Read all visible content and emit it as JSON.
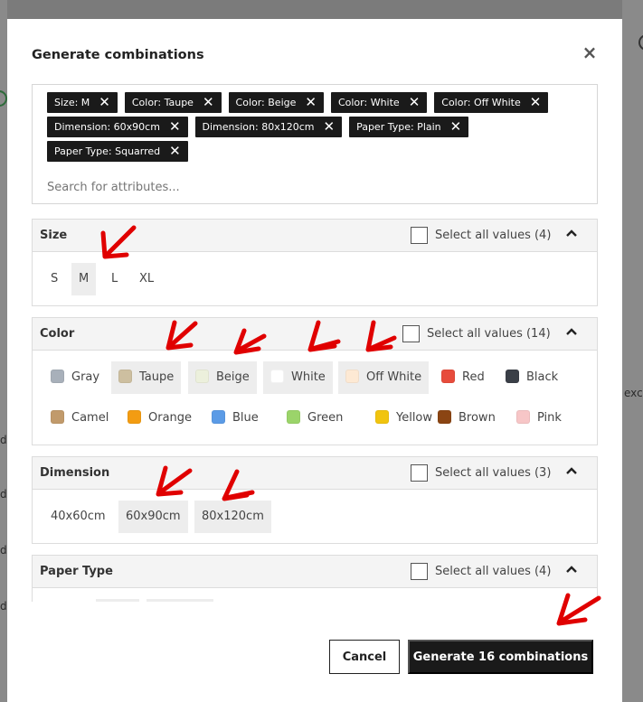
{
  "modal": {
    "title": "Generate combinations",
    "close_icon": "×"
  },
  "tags": [
    {
      "label": "Size: M"
    },
    {
      "label": "Color: Taupe"
    },
    {
      "label": "Color: Beige"
    },
    {
      "label": "Color: White"
    },
    {
      "label": "Color: Off White"
    },
    {
      "label": "Dimension: 60x90cm"
    },
    {
      "label": "Dimension: 80x120cm"
    },
    {
      "label": "Paper Type: Plain"
    },
    {
      "label": "Paper Type: Squarred"
    }
  ],
  "tag_remove_glyph": "✕",
  "search": {
    "placeholder": "Search for attributes..."
  },
  "sections": {
    "size": {
      "title": "Size",
      "select_all": "Select all values (4)",
      "values": [
        "S",
        "M",
        "L",
        "XL"
      ],
      "selected": [
        "M"
      ]
    },
    "color": {
      "title": "Color",
      "select_all": "Select all values (14)",
      "values": [
        {
          "label": "Gray",
          "color": "#a8b0ba"
        },
        {
          "label": "Taupe",
          "color": "#cdbfa0"
        },
        {
          "label": "Beige",
          "color": "#ecf0dc"
        },
        {
          "label": "White",
          "color": "#ffffff"
        },
        {
          "label": "Off White",
          "color": "#fde9d4"
        },
        {
          "label": "Red",
          "color": "#e74c3c"
        },
        {
          "label": "Black",
          "color": "#3a3f47"
        },
        {
          "label": "Camel",
          "color": "#c19a6b"
        },
        {
          "label": "Orange",
          "color": "#f39c12"
        },
        {
          "label": "Blue",
          "color": "#5b9be6"
        },
        {
          "label": "Green",
          "color": "#9bd46a"
        },
        {
          "label": "Yellow",
          "color": "#f1c40f"
        },
        {
          "label": "Brown",
          "color": "#8b4513"
        },
        {
          "label": "Pink",
          "color": "#f7c6c7"
        }
      ],
      "selected": [
        "Taupe",
        "Beige",
        "White",
        "Off White"
      ]
    },
    "dimension": {
      "title": "Dimension",
      "select_all": "Select all values (3)",
      "values": [
        "40x60cm",
        "60x90cm",
        "80x120cm"
      ],
      "selected": [
        "60x90cm",
        "80x120cm"
      ]
    },
    "paper_type": {
      "title": "Paper Type",
      "select_all": "Select all values (4)"
    }
  },
  "chevron_up": "⌃",
  "footer": {
    "cancel_label": "Cancel",
    "generate_label": "Generate 16 combinations"
  },
  "background": {
    "left_text": "d",
    "right_text": "exc"
  },
  "annotation_color": "#e00000"
}
